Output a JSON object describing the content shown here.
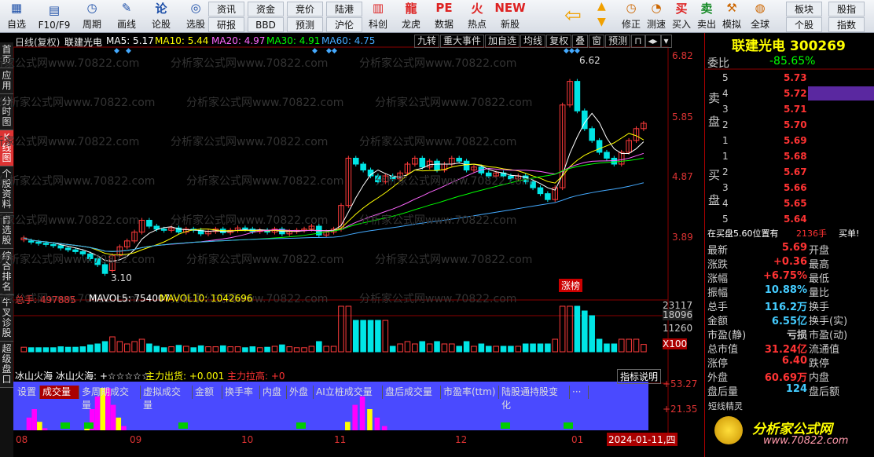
{
  "toolbar": {
    "main": [
      {
        "label": "自选",
        "icon": "grid-icon"
      },
      {
        "label": "F10/F9",
        "icon": "doc-icon"
      },
      {
        "label": "周期",
        "icon": "clock-icon"
      },
      {
        "label": "画线",
        "icon": "pencil-icon"
      },
      {
        "label": "论股",
        "icon": "chat-icon"
      },
      {
        "label": "选股",
        "icon": "gauge-icon"
      }
    ],
    "pairs": [
      [
        "资讯",
        "研报"
      ],
      [
        "资金",
        "BBD"
      ],
      [
        "竞价",
        "预测"
      ],
      [
        "陆港",
        "沪伦"
      ]
    ],
    "right1": [
      {
        "label": "科创",
        "icon": "chart-icon"
      },
      {
        "label": "龙虎",
        "icon": "dragon-icon"
      },
      {
        "label": "数据",
        "icon": "pe-icon"
      },
      {
        "label": "热点",
        "icon": "hot-icon"
      },
      {
        "label": "新股",
        "icon": "new-icon"
      }
    ],
    "right2": [
      {
        "label": "修正",
        "icon": "clock-icon"
      },
      {
        "label": "测速",
        "icon": "speed-icon"
      },
      {
        "label": "买入",
        "icon": "buy-icon"
      },
      {
        "label": "卖出",
        "icon": "sell-icon"
      },
      {
        "label": "模拟",
        "icon": "hammer-icon"
      },
      {
        "label": "全球",
        "icon": "globe-icon"
      }
    ],
    "pairs2": [
      [
        "板块",
        "个股"
      ],
      [
        "股指",
        "指数"
      ]
    ],
    "buy_glyph": "买",
    "sell_glyph": "卖"
  },
  "leftnav": [
    "首页",
    "应用",
    "分时图",
    "K线图",
    "个股资料",
    "自选股",
    "综合排名",
    "牛叉诊股",
    "超级盘口"
  ],
  "chart": {
    "header": {
      "name": "日线(复权)",
      "stock": "联建光电",
      "ma5": "MA5: 5.17",
      "ma10": "MA10: 5.44",
      "ma20": "MA20: 4.97",
      "ma30": "MA30: 4.91",
      "ma60": "MA60: 4.75"
    },
    "right_buttons": [
      "九转",
      "重大事件",
      "加自选",
      "均线",
      "复权",
      "叠",
      "窗",
      "预测"
    ],
    "price_axis": [
      "6.82",
      "5.85",
      "4.87",
      "3.89"
    ],
    "high_label": "6.62",
    "low_label": "3.10",
    "event_tag": "涨榜",
    "vol_header": {
      "total": "总手: 497885",
      "mavol5": "MAVOL5: 754007",
      "mavol10": "MAVOL10: 1042696"
    },
    "vol_axis": [
      "23117",
      "18096",
      "11260",
      "X100"
    ],
    "tabs": [
      "设置",
      "成交量",
      "多周期成交量",
      "虚拟成交量",
      "金额",
      "换手率",
      "内盘",
      "外盘",
      "AI立桩成交量",
      "盘后成交量",
      "市盈率(ttm)",
      "陆股通持股变化",
      "···"
    ],
    "ind_header": {
      "name": "冰山火海",
      "sub": "冰山火海: +☆☆☆☆☆",
      "out": "主力出货: +0.001",
      "up": "主力拉高: +0"
    },
    "ind_button": "指标说明",
    "ind_axis": [
      "+53.27",
      "+21.35"
    ],
    "x_axis": [
      "08",
      "09",
      "10",
      "11",
      "12",
      "01"
    ],
    "date_label": "2024-01-11,四",
    "watermark": "分析家公式网www.70822.com"
  },
  "chart_data": {
    "type": "candlestick",
    "x": [
      "08",
      "09",
      "10",
      "11",
      "12",
      "01"
    ],
    "price_range": [
      3.1,
      6.82
    ],
    "candles": [
      [
        3.72,
        3.75
      ],
      [
        3.7,
        3.68
      ],
      [
        3.68,
        3.66
      ],
      [
        3.66,
        3.64
      ],
      [
        3.64,
        3.62
      ],
      [
        3.62,
        3.58
      ],
      [
        3.58,
        3.55
      ],
      [
        3.55,
        3.52
      ],
      [
        3.52,
        3.48
      ],
      [
        3.48,
        3.4
      ],
      [
        3.4,
        3.3
      ],
      [
        3.3,
        3.15
      ],
      [
        3.2,
        3.45
      ],
      [
        3.45,
        3.6
      ],
      [
        3.6,
        3.7
      ],
      [
        3.7,
        3.85
      ],
      [
        3.85,
        4.05
      ],
      [
        4.05,
        3.95
      ],
      [
        3.95,
        3.9
      ],
      [
        3.9,
        3.88
      ],
      [
        3.88,
        3.92
      ],
      [
        3.92,
        3.85
      ],
      [
        3.85,
        3.9
      ],
      [
        3.9,
        3.88
      ],
      [
        3.88,
        3.82
      ],
      [
        3.82,
        3.86
      ],
      [
        3.86,
        3.9
      ],
      [
        3.9,
        3.84
      ],
      [
        3.84,
        3.88
      ],
      [
        3.88,
        3.92
      ],
      [
        3.92,
        3.9
      ],
      [
        3.9,
        3.86
      ],
      [
        3.86,
        3.88
      ],
      [
        3.88,
        3.85
      ],
      [
        3.85,
        3.9
      ],
      [
        3.9,
        3.82
      ],
      [
        3.82,
        3.86
      ],
      [
        3.86,
        3.88
      ],
      [
        3.88,
        3.9
      ],
      [
        3.9,
        3.95
      ],
      [
        3.95,
        3.8
      ],
      [
        3.8,
        3.85
      ],
      [
        3.85,
        3.9
      ],
      [
        3.9,
        4.3
      ],
      [
        4.3,
        5.1
      ],
      [
        5.1,
        5.0
      ],
      [
        5.0,
        4.9
      ],
      [
        4.9,
        4.8
      ],
      [
        4.8,
        4.7
      ],
      [
        4.7,
        4.8
      ],
      [
        4.8,
        4.75
      ],
      [
        4.75,
        4.85
      ],
      [
        4.85,
        5.0
      ],
      [
        5.0,
        5.1
      ],
      [
        5.1,
        4.95
      ],
      [
        4.95,
        5.05
      ],
      [
        5.05,
        4.9
      ],
      [
        4.9,
        5.0
      ],
      [
        5.0,
        5.1
      ],
      [
        5.1,
        5.05
      ],
      [
        5.05,
        4.9
      ],
      [
        4.9,
        4.95
      ],
      [
        4.95,
        4.85
      ],
      [
        4.85,
        4.8
      ],
      [
        4.8,
        4.85
      ],
      [
        4.85,
        4.8
      ],
      [
        4.8,
        4.75
      ],
      [
        4.75,
        4.8
      ],
      [
        4.8,
        4.7
      ],
      [
        4.7,
        4.6
      ],
      [
        4.6,
        4.5
      ],
      [
        4.5,
        4.4
      ],
      [
        4.4,
        4.6
      ],
      [
        4.6,
        6.0
      ],
      [
        6.0,
        6.4
      ],
      [
        6.4,
        5.9
      ],
      [
        5.9,
        5.6
      ],
      [
        5.6,
        5.4
      ],
      [
        5.4,
        5.2
      ],
      [
        5.2,
        5.1
      ],
      [
        5.1,
        5.0
      ],
      [
        5.0,
        5.2
      ],
      [
        5.2,
        5.4
      ],
      [
        5.4,
        5.6
      ],
      [
        5.6,
        5.69
      ]
    ],
    "ma": {
      "ma5": 5.17,
      "ma10": 5.44,
      "ma20": 4.97,
      "ma30": 4.91,
      "ma60": 4.75
    },
    "volume": {
      "total": 497885,
      "mavol5": 754007,
      "mavol10": 1042696
    },
    "colors": {
      "up": "#ff3b3b",
      "down": "#00e5e5",
      "ma5": "#ffffff",
      "ma10": "#ffff00",
      "ma20": "#ff66ff",
      "ma30": "#00ff00",
      "ma60": "#44aaff",
      "bg": "#000000",
      "indicator_bg": "#4a4aff"
    }
  },
  "sidebar": {
    "title": "联建光电 300269",
    "weibi_label": "委比",
    "weibi_val": "-85.65%",
    "sell_label_top": "卖",
    "sell_label_bot": "盘",
    "buy_label_top": "买",
    "buy_label_bot": "盘",
    "sells": [
      [
        "5",
        "5.73"
      ],
      [
        "4",
        "5.72"
      ],
      [
        "3",
        "5.71"
      ],
      [
        "2",
        "5.70"
      ],
      [
        "1",
        "5.69"
      ]
    ],
    "buys": [
      [
        "1",
        "5.68"
      ],
      [
        "2",
        "5.67"
      ],
      [
        "3",
        "5.66"
      ],
      [
        "4",
        "5.65"
      ],
      [
        "5",
        "5.64"
      ]
    ],
    "notice": "在买盘5.60位置有",
    "notice_amt": "2136手",
    "notice_act": "买单!",
    "stats": [
      [
        "最新",
        "5.69",
        "开盘"
      ],
      [
        "涨跌",
        "+0.36",
        "最高"
      ],
      [
        "涨幅",
        "+6.75%",
        "最低"
      ],
      [
        "振幅",
        "10.88%",
        "量比"
      ],
      [
        "总手",
        "116.2万",
        "换手"
      ],
      [
        "金额",
        "6.55亿",
        "换手(实)"
      ],
      [
        "市盈(静)",
        "亏损",
        "市盈(动)"
      ],
      [
        "总市值",
        "31.24亿",
        "流通值"
      ],
      [
        "涨停",
        "6.40",
        "跌停"
      ],
      [
        "外盘",
        "60.69万",
        "内盘"
      ],
      [
        "盘后量",
        "124",
        "盘后额"
      ]
    ],
    "panel": "短线精灵",
    "logo": "分析家公式网",
    "logo_url": "www.70822.com"
  }
}
